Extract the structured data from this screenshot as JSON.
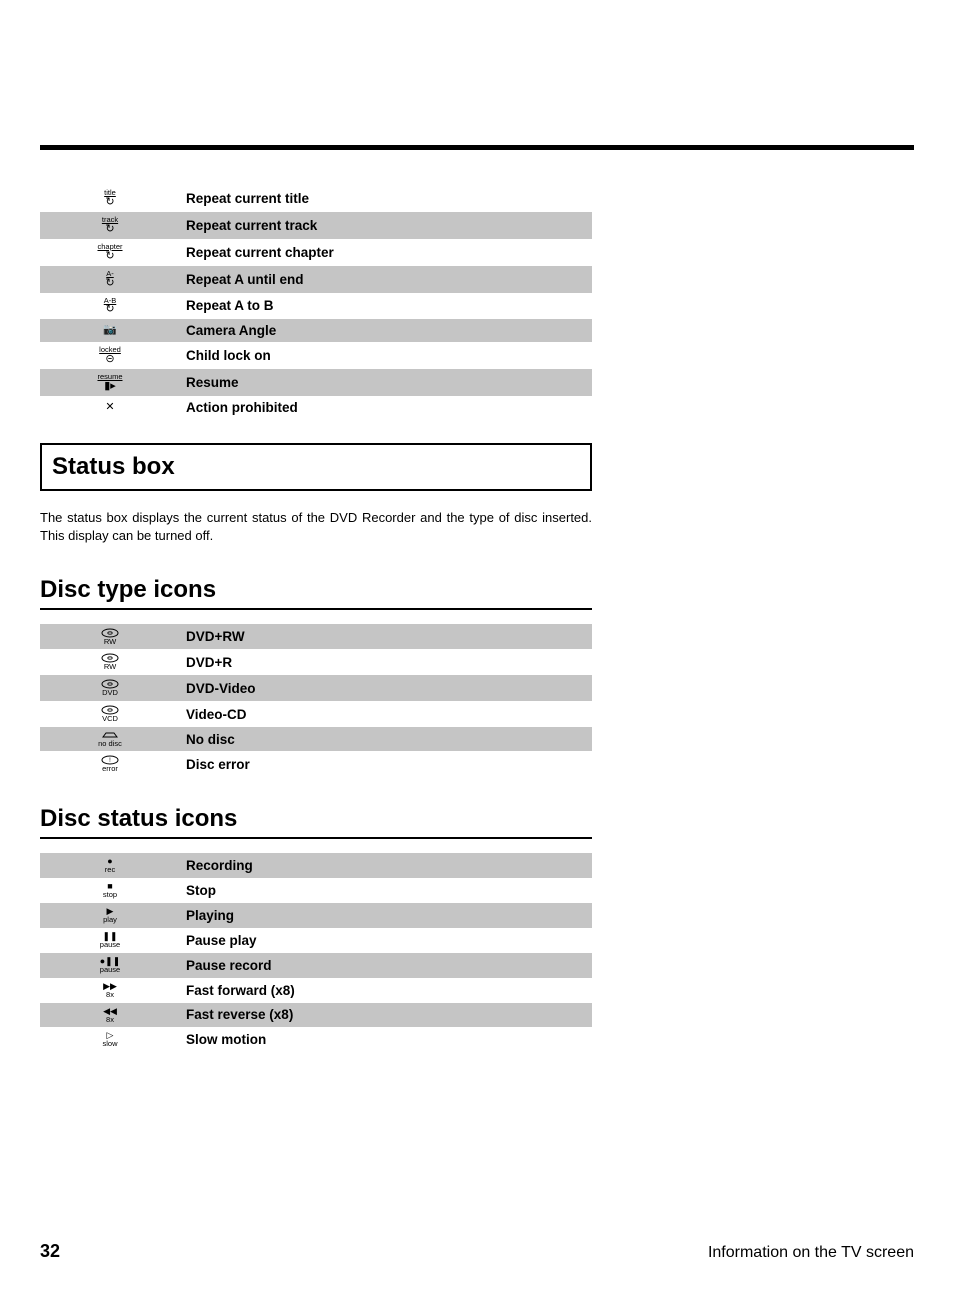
{
  "table1": [
    {
      "icon_label": "title",
      "glyph": "↻",
      "label": "Repeat current title"
    },
    {
      "icon_label": "track",
      "glyph": "↻",
      "label": "Repeat current track"
    },
    {
      "icon_label": "chapter",
      "glyph": "↻",
      "label": "Repeat current chapter"
    },
    {
      "icon_label": "A-",
      "glyph": "↻",
      "label": "Repeat A until end"
    },
    {
      "icon_label": "A-B",
      "glyph": "↻",
      "label": "Repeat A to B"
    },
    {
      "icon_label": "",
      "glyph": "📷",
      "label": "Camera Angle"
    },
    {
      "icon_label": "locked",
      "glyph": "⊝",
      "label": "Child lock on"
    },
    {
      "icon_label": "resume",
      "glyph": "▮▸",
      "label": "Resume"
    },
    {
      "icon_label": "",
      "glyph": "✕",
      "label": "Action prohibited"
    }
  ],
  "status_box": {
    "heading": "Status box",
    "body": "The status box displays the current status of the DVD Recorder and the type of disc inserted. This display can be turned off."
  },
  "disc_type": {
    "heading": "Disc type icons",
    "rows": [
      {
        "sub": "RW",
        "type": "disc",
        "label": "DVD+RW"
      },
      {
        "sub": "RW",
        "type": "disc",
        "label": "DVD+R"
      },
      {
        "sub": "DVD",
        "type": "disc",
        "label": "DVD-Video"
      },
      {
        "sub": "VCD",
        "type": "disc",
        "label": "Video-CD"
      },
      {
        "sub": "no disc",
        "type": "tray",
        "label": "No disc"
      },
      {
        "sub": "error",
        "type": "disc-err",
        "label": "Disc error"
      }
    ]
  },
  "disc_status": {
    "heading": "Disc status icons",
    "rows": [
      {
        "glyph": "●",
        "sub": "rec",
        "label": "Recording"
      },
      {
        "glyph": "■",
        "sub": "stop",
        "label": "Stop"
      },
      {
        "glyph": "▶",
        "sub": "play",
        "label": "Playing"
      },
      {
        "glyph": "❚❚",
        "sub": "pause",
        "label": "Pause play"
      },
      {
        "glyph": "●❚❚",
        "sub": "pause",
        "label": "Pause record"
      },
      {
        "glyph": "▶▶",
        "sub": "8x",
        "label": "Fast forward (x8)"
      },
      {
        "glyph": "◀◀",
        "sub": "8x",
        "label": "Fast reverse (x8)"
      },
      {
        "glyph": "▷",
        "sub": "slow",
        "label": "Slow motion"
      }
    ]
  },
  "footer": {
    "page": "32",
    "title": "Information on the TV screen"
  }
}
